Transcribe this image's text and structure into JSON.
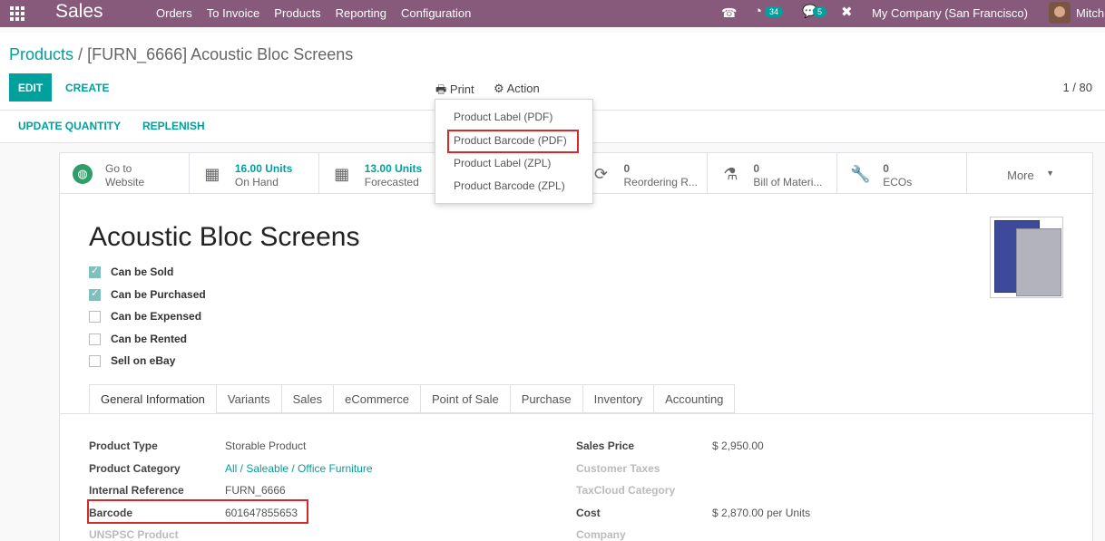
{
  "navbar": {
    "brand": "Sales",
    "menu": [
      "Orders",
      "To Invoice",
      "Products",
      "Reporting",
      "Configuration"
    ],
    "activity_count": "34",
    "message_count": "5",
    "company": "My Company (San Francisco)",
    "user": "Mitch",
    "icons": {
      "apps": "apps-grid-icon",
      "phone": "phone-icon",
      "activity": "clock-icon",
      "chat": "chat-icon",
      "debug": "wrench-icon"
    }
  },
  "breadcrumb": {
    "parent": "Products",
    "separator": "/",
    "current": "[FURN_6666] Acoustic Bloc Screens"
  },
  "control": {
    "edit_label": "EDIT",
    "create_label": "CREATE",
    "print_label": "Print",
    "action_label": "Action",
    "pager": "1 / 80"
  },
  "statusbar": {
    "update_quantity": "UPDATE QUANTITY",
    "replenish": "REPLENISH"
  },
  "stats": [
    {
      "line1": "Go to",
      "line2": "Website",
      "icon": "globe-icon"
    },
    {
      "line1": "16.00 Units",
      "line2": "On Hand",
      "icon": "cubes-icon"
    },
    {
      "line1": "13.00 Units",
      "line2": "Forecasted",
      "icon": "cubes-icon"
    },
    {
      "line1": "",
      "line2": "",
      "icon": ""
    },
    {
      "line1": "0",
      "line2": "Reordering R...",
      "icon": "refresh-icon"
    },
    {
      "line1": "0",
      "line2": "Bill of Materi...",
      "icon": "flask-icon"
    },
    {
      "line1": "0",
      "line2": "ECOs",
      "icon": "wrench-icon"
    }
  ],
  "more_label": "More",
  "product": {
    "title": "Acoustic Bloc Screens",
    "options": [
      {
        "label": "Can be Sold",
        "checked": true
      },
      {
        "label": "Can be Purchased",
        "checked": true
      },
      {
        "label": "Can be Expensed",
        "checked": false
      },
      {
        "label": "Can be Rented",
        "checked": false
      },
      {
        "label": "Sell on eBay",
        "checked": false
      }
    ]
  },
  "tabs": [
    "General Information",
    "Variants",
    "Sales",
    "eCommerce",
    "Point of Sale",
    "Purchase",
    "Inventory",
    "Accounting"
  ],
  "fields_left": [
    {
      "label": "Product Type",
      "value": "Storable Product"
    },
    {
      "label": "Product Category",
      "value": "All / Saleable / Office Furniture"
    },
    {
      "label": "Internal Reference",
      "value": "FURN_6666"
    },
    {
      "label": "Barcode",
      "value": "601647855653"
    },
    {
      "label": "UNSPSC Product",
      "value": ""
    }
  ],
  "fields_right": [
    {
      "label": "Sales Price",
      "value": "$ 2,950.00"
    },
    {
      "label": "Customer Taxes",
      "value": ""
    },
    {
      "label": "TaxCloud Category",
      "value": ""
    },
    {
      "label": "Cost",
      "value": "$ 2,870.00",
      "unit": "per Units"
    },
    {
      "label": "Company",
      "value": ""
    }
  ],
  "print_menu": [
    "Product Label (PDF)",
    "Product Barcode (PDF)",
    "Product Label (ZPL)",
    "Product Barcode (ZPL)"
  ],
  "colors": {
    "primary": "#875a7b",
    "accent": "#00a09d",
    "highlight": "#d62a2a"
  }
}
